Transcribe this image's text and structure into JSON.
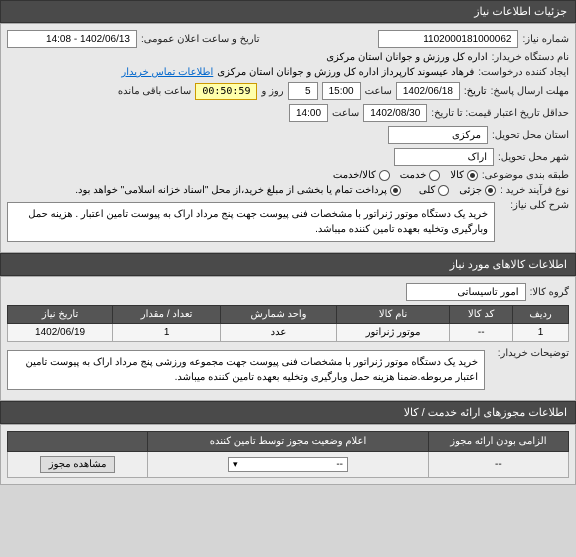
{
  "sections": {
    "need_info_header": "جزئیات اطلاعات نیاز",
    "goods_info_header": "اطلاعات کالاهای مورد نیاز",
    "licenses_header": "اطلاعات مجوزهای ارائه خدمت / کالا"
  },
  "labels": {
    "need_no": "شماره نیاز:",
    "announce_date": "تاریخ و ساعت اعلان عمومی:",
    "buyer_org": "نام دستگاه خریدار:",
    "requester": "ایجاد کننده درخواست:",
    "contact_link": "اطلاعات تماس خریدار",
    "response_deadline": "مهلت ارسال پاسخ:",
    "hour": "ساعت",
    "day_and": "روز و",
    "remaining": "ساعت باقی مانده",
    "min_valid_date": "حداقل تاریخ اعتبار قیمت: تا تاریخ:",
    "province": "استان محل تحویل:",
    "city": "شهر محل تحویل:",
    "subject_category": "طبقه بندی موضوعی:",
    "goods": "کالا",
    "service": "خدمت",
    "goods_service": "کالا/خدمت",
    "purchase_process": "نوع فرآیند خرید :",
    "partial": "جزئی",
    "full": "کلی",
    "payment_note": "پرداخت تمام یا بخشی از مبلغ خرید،از محل \"اسناد خزانه اسلامی\" خواهد بود.",
    "general_desc": "شرح کلی نیاز:",
    "goods_group": "گروه کالا:",
    "buyer_notes": "توضیحات خریدار:",
    "mandatory_license": "الزامی بودن ارائه مجوز",
    "status_declare": "اعلام وضعیت مجوز توسط تامین کننده",
    "view_license": "مشاهده مجوز"
  },
  "values": {
    "need_no": "1102000181000062",
    "announce_date": "1402/06/13 - 14:08",
    "buyer_org": "اداره کل ورزش و جوانان استان مرکزی",
    "requester": "فرهاد عیسوند کارپرداز اداره کل ورزش و جوانان استان مرکزی",
    "deadline_date": "1402/06/18",
    "deadline_time": "15:00",
    "days_remaining": "5",
    "countdown": "00:50:59",
    "valid_date": "1402/08/30",
    "valid_time": "14:00",
    "province": "مرکزی",
    "city": "اراک",
    "general_desc": "خرید یک دستگاه موتور ژنراتور با مشخصات فنی پیوست جهت  پنج مرداد اراک به پیوست تامین اعتبار . هزینه حمل وبارگیری وتخلیه بعهده تامین کننده میباشد.",
    "goods_group": "امور تاسیساتی",
    "buyer_notes": "خرید یک دستگاه موتور ژنراتور با مشخصات فنی پیوست جهت مجموعه ورزشی پنج مرداد اراک به پیوست تامین اعتبار مربوطه.ضمنا هزینه حمل وبارگیری وتخلیه بعهده تامین کننده میباشد.",
    "license_mandatory": "--",
    "license_status": "--"
  },
  "table": {
    "headers": {
      "row": "ردیف",
      "code": "کد کالا",
      "name": "نام کالا",
      "unit": "واحد شمارش",
      "qty": "تعداد / مقدار",
      "need_date": "تاریخ نیاز"
    },
    "rows": [
      {
        "row": "1",
        "code": "--",
        "name": "موتور ژنراتور",
        "unit": "عدد",
        "qty": "1",
        "need_date": "1402/06/19"
      }
    ]
  }
}
